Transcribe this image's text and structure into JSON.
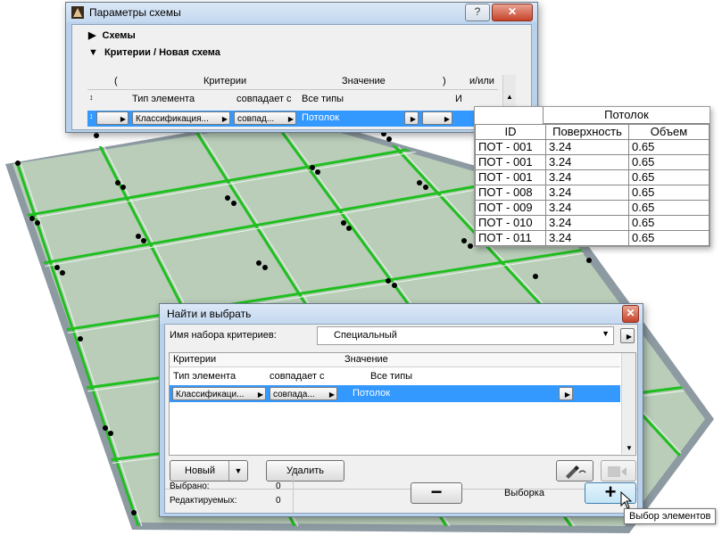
{
  "scheme_window": {
    "title": "Параметры схемы",
    "section_schemes": "Схемы",
    "section_criteria": "Критерии / Новая схема",
    "columns": [
      "(",
      "Критерии",
      "Значение",
      ")",
      "и/или"
    ],
    "row1": {
      "criterion": "Тип элемента",
      "operator": "совпадает с",
      "value": "Все типы",
      "andor": "И"
    },
    "row2": {
      "criterion": "Классификация...",
      "operator": "совпад...",
      "value": "Потолок"
    }
  },
  "schedule_table": {
    "title": "Потолок",
    "headers": [
      "ID",
      "Поверхность",
      "Объем"
    ],
    "rows": [
      [
        "ПОТ - 001",
        "3.24",
        "0.65"
      ],
      [
        "ПОТ - 001",
        "3.24",
        "0.65"
      ],
      [
        "ПОТ - 001",
        "3.24",
        "0.65"
      ],
      [
        "ПОТ - 008",
        "3.24",
        "0.65"
      ],
      [
        "ПОТ - 009",
        "3.24",
        "0.65"
      ],
      [
        "ПОТ - 010",
        "3.24",
        "0.65"
      ],
      [
        "ПОТ - 011",
        "3.24",
        "0.65"
      ]
    ]
  },
  "find_window": {
    "title": "Найти и выбрать",
    "criteria_set_label": "Имя набора критериев:",
    "criteria_set_value": "Специальный",
    "col_criteria": "Критерии",
    "col_value": "Значение",
    "row1": {
      "criterion": "Тип элемента",
      "operator": "совпадает с",
      "value": "Все типы"
    },
    "row2": {
      "criterion": "Классификаци...",
      "operator": "совпада...",
      "value": "Потолок"
    },
    "new_button": "Новый",
    "delete_button": "Удалить",
    "selected_label": "Выбрано:",
    "selected_value": "0",
    "editable_label": "Редактируемых:",
    "editable_value": "0",
    "selection_label": "Выборка",
    "tooltip": "Выбор элементов"
  },
  "colors": {
    "highlight": "#3399ff",
    "grid_green": "#1fbf1f",
    "panel_fill": "#b9cdb9"
  }
}
